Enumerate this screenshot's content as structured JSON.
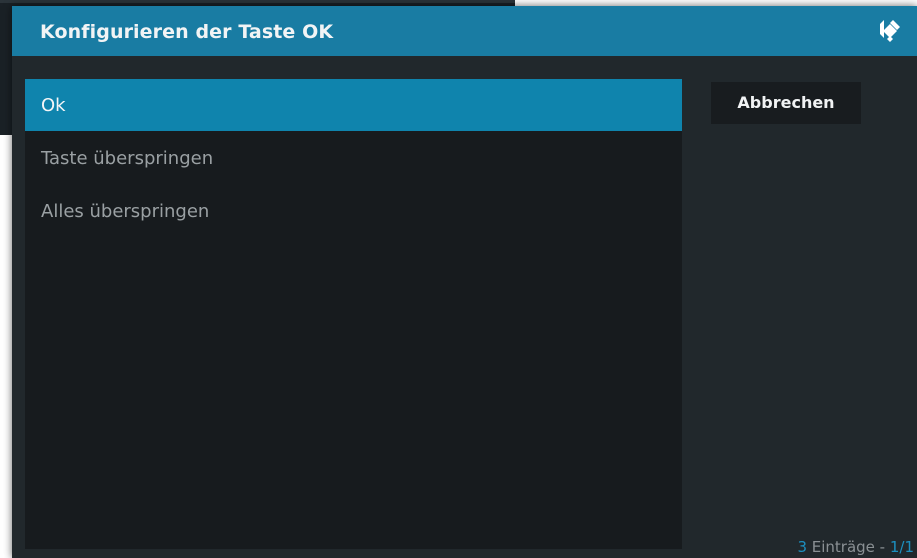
{
  "dialog": {
    "title": "Konfigurieren der Taste OK",
    "logo_icon": "kodi-logo-icon",
    "items": [
      {
        "label": "Ok",
        "selected": true
      },
      {
        "label": "Taste überspringen",
        "selected": false
      },
      {
        "label": "Alles überspringen",
        "selected": false
      }
    ],
    "cancel_label": "Abbrechen",
    "count": {
      "number": "3",
      "label": " Einträge - ",
      "page": "1/1"
    }
  },
  "colors": {
    "header": "#197ca3",
    "selected": "#0f84ad",
    "dialog_bg": "#21282c",
    "list_bg": "#171b1e",
    "accent": "#1c8fbf"
  }
}
